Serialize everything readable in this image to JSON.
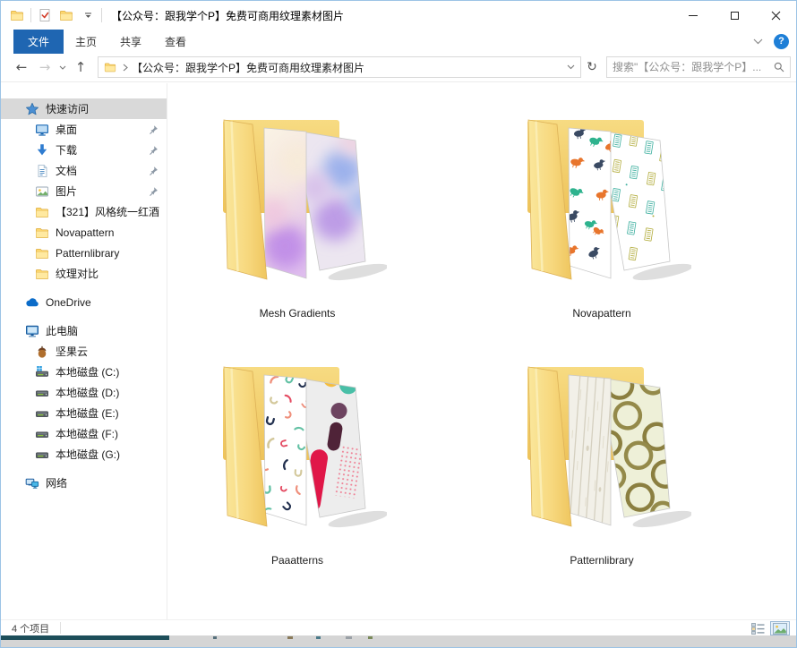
{
  "window": {
    "title": "【公众号：跟我学个P】免费可商用纹理素材图片"
  },
  "colors": {
    "accent_blue": "#1f66b2",
    "help_blue": "#1e7fd7",
    "selection_gray": "#d9d9d9",
    "folder_yellow": "#f7d878",
    "taskbar_teal": "#1d4e5a"
  },
  "qat": {
    "icons": [
      "explorer-folder-icon",
      "checkmark-document-icon",
      "folder-icon",
      "qat-dropdown-caret-icon"
    ]
  },
  "menu": {
    "tabs": [
      {
        "label": "文件",
        "active": true
      },
      {
        "label": "主页",
        "active": false
      },
      {
        "label": "共享",
        "active": false
      },
      {
        "label": "查看",
        "active": false
      }
    ],
    "help_glyph": "?"
  },
  "navbar": {
    "icons": {
      "back": "←",
      "forward": "→",
      "up": "↑",
      "refresh": "↻"
    },
    "address": {
      "path": "【公众号：跟我学个P】免费可商用纹理素材图片"
    },
    "search": {
      "placeholder": "搜索\"【公众号：跟我学个P】... "
    }
  },
  "sidebar": {
    "items": [
      {
        "id": "quick-access",
        "label": "快速访问",
        "icon": "quick-access-star",
        "level": 1,
        "selected": true,
        "pinned": false,
        "gap": false
      },
      {
        "id": "desktop",
        "label": "桌面",
        "icon": "desktop",
        "level": 2,
        "selected": false,
        "pinned": true,
        "gap": false
      },
      {
        "id": "downloads",
        "label": "下载",
        "icon": "downloads",
        "level": 2,
        "selected": false,
        "pinned": true,
        "gap": false
      },
      {
        "id": "documents",
        "label": "文档",
        "icon": "documents",
        "level": 2,
        "selected": false,
        "pinned": true,
        "gap": false
      },
      {
        "id": "pictures",
        "label": "图片",
        "icon": "pictures",
        "level": 2,
        "selected": false,
        "pinned": true,
        "gap": false
      },
      {
        "id": "folder-321-red-wine",
        "label": "【321】风格统一红酒",
        "icon": "folder",
        "level": 2,
        "selected": false,
        "pinned": false,
        "gap": false
      },
      {
        "id": "novapattern",
        "label": "Novapattern",
        "icon": "folder",
        "level": 2,
        "selected": false,
        "pinned": false,
        "gap": false
      },
      {
        "id": "patternlibrary",
        "label": "Patternlibrary",
        "icon": "folder",
        "level": 2,
        "selected": false,
        "pinned": false,
        "gap": false
      },
      {
        "id": "texture-compare",
        "label": "纹理对比",
        "icon": "folder",
        "level": 2,
        "selected": false,
        "pinned": false,
        "gap": false
      },
      {
        "id": "onedrive",
        "label": "OneDrive",
        "icon": "onedrive",
        "level": 1,
        "selected": false,
        "pinned": false,
        "gap": true
      },
      {
        "id": "this-pc",
        "label": "此电脑",
        "icon": "this-pc",
        "level": 1,
        "selected": false,
        "pinned": false,
        "gap": true
      },
      {
        "id": "nutstore",
        "label": "坚果云",
        "icon": "nutstore",
        "level": 2,
        "selected": false,
        "pinned": false,
        "gap": false
      },
      {
        "id": "disk-c",
        "label": "本地磁盘 (C:)",
        "icon": "drive-c",
        "level": 2,
        "selected": false,
        "pinned": false,
        "gap": false
      },
      {
        "id": "disk-d",
        "label": "本地磁盘 (D:)",
        "icon": "drive",
        "level": 2,
        "selected": false,
        "pinned": false,
        "gap": false
      },
      {
        "id": "disk-e",
        "label": "本地磁盘 (E:)",
        "icon": "drive",
        "level": 2,
        "selected": false,
        "pinned": false,
        "gap": false
      },
      {
        "id": "disk-f",
        "label": "本地磁盘 (F:)",
        "icon": "drive",
        "level": 2,
        "selected": false,
        "pinned": false,
        "gap": false
      },
      {
        "id": "disk-g",
        "label": "本地磁盘 (G:)",
        "icon": "drive",
        "level": 2,
        "selected": false,
        "pinned": false,
        "gap": false
      },
      {
        "id": "network",
        "label": "网络",
        "icon": "network",
        "level": 1,
        "selected": false,
        "pinned": false,
        "gap": true
      }
    ]
  },
  "content": {
    "folders": [
      {
        "label": "Mesh Gradients"
      },
      {
        "label": "Novapattern"
      },
      {
        "label": "Paaatterns"
      },
      {
        "label": "Patternlibrary"
      }
    ]
  },
  "statusbar": {
    "items_count": "4 个项目"
  }
}
